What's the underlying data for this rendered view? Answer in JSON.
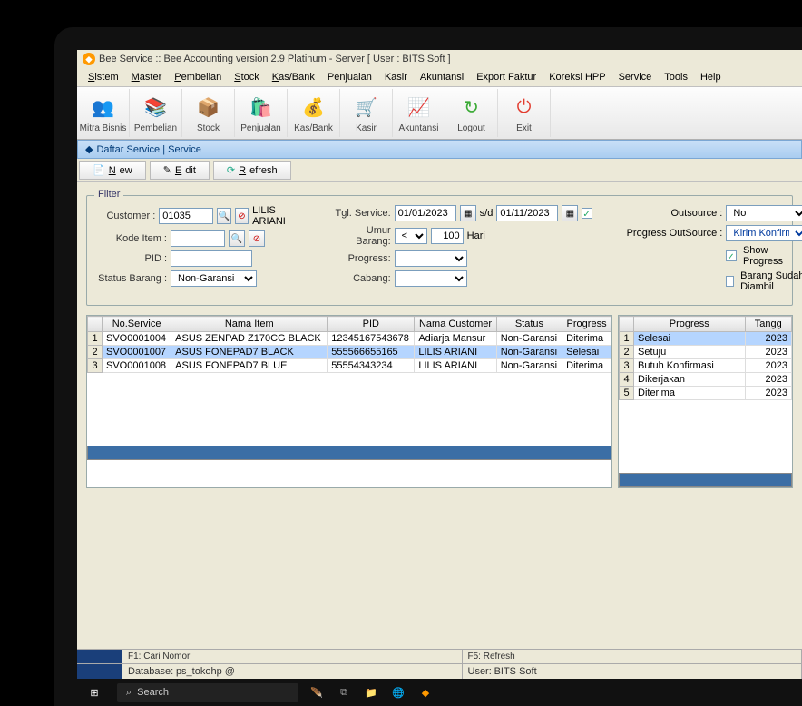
{
  "window": {
    "title": "Bee Service :: Bee Accounting version 2.9 Platinum - Server  [ User : BITS Soft ]"
  },
  "menu": [
    "Sistem",
    "Master",
    "Pembelian",
    "Stock",
    "Kas/Bank",
    "Penjualan",
    "Kasir",
    "Akuntansi",
    "Export Faktur",
    "Koreksi HPP",
    "Service",
    "Tools",
    "Help"
  ],
  "menu_underline": [
    "S",
    "M",
    "P",
    "S",
    "K",
    "",
    "",
    "",
    "",
    "",
    "",
    "",
    ""
  ],
  "toolbar": [
    {
      "label": "Mitra Bisnis",
      "icon": "👥",
      "bg": "#ffe9b0"
    },
    {
      "label": "Pembelian",
      "icon": "📚",
      "bg": "#f3c06b"
    },
    {
      "label": "Stock",
      "icon": "📦",
      "bg": "#e8a54a"
    },
    {
      "label": "Penjualan",
      "icon": "🛍️",
      "bg": "#2e6bd6"
    },
    {
      "label": "Kas/Bank",
      "icon": "💰",
      "bg": "#e8a54a"
    },
    {
      "label": "Kasir",
      "icon": "🛒",
      "bg": "#e07b33"
    },
    {
      "label": "Akuntansi",
      "icon": "📈",
      "bg": "#49b04a"
    },
    {
      "label": "Logout",
      "icon": "↻",
      "bg": "#3aaa35"
    },
    {
      "label": "Exit",
      "icon": "⏻",
      "bg": "#e23b2e"
    }
  ],
  "sub_title": "Daftar Service | Service",
  "actions": {
    "new": "New",
    "edit": "Edit",
    "refresh": "Refresh"
  },
  "filter": {
    "legend": "Filter",
    "customer_label": "Customer :",
    "customer_val": "01035",
    "customer_name": "LILIS ARIANI",
    "kode_label": "Kode Item :",
    "kode_val": "",
    "pid_label": "PID :",
    "pid_val": "",
    "status_label": "Status Barang :",
    "status_val": "Non-Garansi",
    "tgl_label": "Tgl. Service:",
    "tgl_from": "01/01/2023",
    "sd": "s/d",
    "tgl_to": "01/11/2023",
    "umur_label": "Umur Barang:",
    "umur_op": "<",
    "umur_val": "100",
    "hari": "Hari",
    "progress_label": "Progress:",
    "progress_val": "",
    "cabang_label": "Cabang:",
    "cabang_val": "",
    "outsource_label": "Outsource :",
    "outsource_val": "No",
    "prog_out_label": "Progress OutSource :",
    "prog_out_val": "Kirim Konfirmasi",
    "show_progress": "Show Progress",
    "barang_diambil": "Barang Sudah Diambil"
  },
  "main_table": {
    "headers": [
      "No.Service",
      "Nama Item",
      "PID",
      "Nama Customer",
      "Status",
      "Progress"
    ],
    "rows": [
      {
        "n": "1",
        "no": "SVO0001004",
        "item": "ASUS ZENPAD Z170CG BLACK",
        "pid": "12345167543678",
        "cust": "Adiarja Mansur",
        "status": "Non-Garansi",
        "prog": "Diterima",
        "sel": false
      },
      {
        "n": "2",
        "no": "SVO0001007",
        "item": "ASUS FONEPAD7 BLACK",
        "pid": "555566655165",
        "cust": "LILIS ARIANI",
        "status": "Non-Garansi",
        "prog": "Selesai",
        "sel": true
      },
      {
        "n": "3",
        "no": "SVO0001008",
        "item": "ASUS FONEPAD7 BLUE",
        "pid": "55554343234",
        "cust": "LILIS ARIANI",
        "status": "Non-Garansi",
        "prog": "Diterima",
        "sel": false
      }
    ]
  },
  "side_table": {
    "headers": [
      "Progress",
      "Tangg"
    ],
    "rows": [
      {
        "n": "1",
        "p": "Selesai",
        "t": "2023",
        "sel": true
      },
      {
        "n": "2",
        "p": "Setuju",
        "t": "2023"
      },
      {
        "n": "3",
        "p": "Butuh Konfirmasi",
        "t": "2023"
      },
      {
        "n": "4",
        "p": "Dikerjakan",
        "t": "2023"
      },
      {
        "n": "5",
        "p": "Diterima",
        "t": "2023"
      }
    ]
  },
  "status_bar": {
    "f1": "F1: Cari Nomor",
    "f5": "F5: Refresh",
    "db_label": "Database:",
    "db": "ps_tokohp @",
    "user_label": "User:",
    "user": "BITS Soft"
  },
  "taskbar": {
    "search": "Search"
  }
}
